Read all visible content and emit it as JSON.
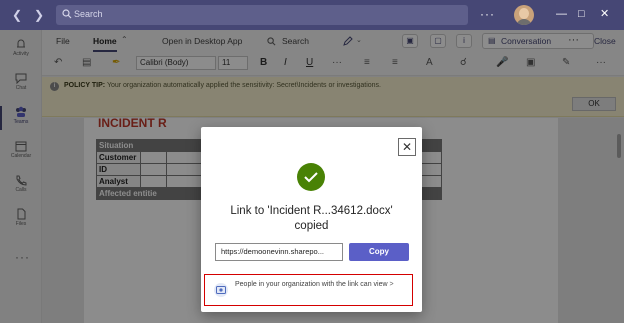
{
  "titlebar": {
    "search_placeholder": "Search",
    "more": "···"
  },
  "rail": {
    "items": [
      {
        "label": "Activity",
        "icon": "bell-icon"
      },
      {
        "label": "Chat",
        "icon": "chat-icon"
      },
      {
        "label": "Teams",
        "icon": "teams-icon"
      },
      {
        "label": "Calendar",
        "icon": "calendar-icon"
      },
      {
        "label": "Calls",
        "icon": "phone-icon"
      },
      {
        "label": "Files",
        "icon": "file-icon"
      }
    ],
    "more": "···"
  },
  "menu": {
    "file": "File",
    "home": "Home",
    "open_desktop": "Open in Desktop App",
    "search": "Search",
    "conversation": "Conversation",
    "more": "···",
    "close": "Close"
  },
  "ribbon": {
    "font": "Calibri (Body)",
    "size": "11",
    "bold": "B",
    "italic": "I",
    "underline": "U",
    "more": "···"
  },
  "policy": {
    "label": "POLICY TIP:",
    "text": "Your organization automatically applied the sensitivity: Secret\\Incidents or investigations.",
    "ok": "OK"
  },
  "document": {
    "heading": "INCIDENT R",
    "table_header_situation": "Situation",
    "row_customer": "Customer",
    "row_id": "ID",
    "row_analyst": "Analyst",
    "row_affected": "Affected entitie"
  },
  "dialog": {
    "close": "✕",
    "title_line1": "Link to 'Incident R...34612.docx'",
    "title_line2": "copied",
    "link_value": "https://demoonevinn.sharepo...",
    "copy_label": "Copy",
    "permission_text": "People in your organization with the link can view",
    "permission_chevron": ">"
  },
  "colors": {
    "titlebar": "#464775",
    "accent": "#5b5fc7",
    "success": "#498205",
    "highlight_border": "#d40000",
    "heading_red": "#c0392b"
  }
}
